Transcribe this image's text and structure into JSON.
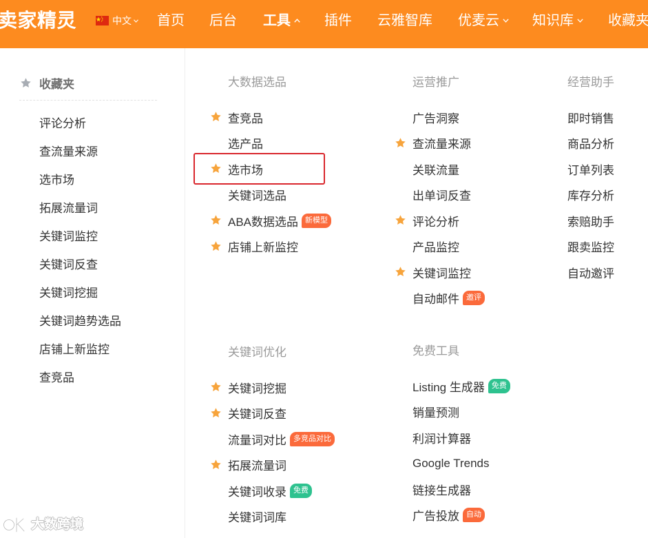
{
  "header": {
    "logo": "卖家精灵",
    "background": "#fd8b1f",
    "language": {
      "label": "中文",
      "flag_icon": "china-flag-icon",
      "chevron_icon": "chevron-down-icon"
    },
    "nav": [
      {
        "label": "首页"
      },
      {
        "label": "后台"
      },
      {
        "label": "工具",
        "active": true,
        "chevron_icon": "chevron-up-icon"
      },
      {
        "label": "插件"
      },
      {
        "label": "云雅智库"
      },
      {
        "label": "优麦云",
        "chevron_icon": "chevron-down-icon"
      },
      {
        "label": "知识库",
        "chevron_icon": "chevron-down-icon"
      },
      {
        "label": "收藏夹"
      }
    ]
  },
  "favorites": {
    "title": "收藏夹",
    "icon": "star-icon",
    "icon_color": "#a8adb4",
    "items": [
      "评论分析",
      "查流量来源",
      "选市场",
      "拓展流量词",
      "关键词监控",
      "关键词反查",
      "关键词挖掘",
      "关键词趋势选品",
      "店铺上新监控",
      "查竞品"
    ]
  },
  "menu": {
    "star_icon": "star-icon",
    "star_color": "#f7a43c",
    "highlight_color": "#d9262c",
    "groups": [
      {
        "title": "大数据选品",
        "items": [
          {
            "label": "查竞品",
            "starred": true
          },
          {
            "label": "选产品"
          },
          {
            "label": "选市场",
            "starred": true,
            "highlighted": true
          },
          {
            "label": "关键词选品"
          },
          {
            "label": "ABA数据选品",
            "starred": true,
            "badge": "新模型",
            "badge_color": "#fb6a3b"
          },
          {
            "label": "店铺上新监控",
            "starred": true
          }
        ]
      },
      {
        "title": "运营推广",
        "items": [
          {
            "label": "广告洞察"
          },
          {
            "label": "查流量来源",
            "starred": true
          },
          {
            "label": "关联流量"
          },
          {
            "label": "出单词反查"
          },
          {
            "label": "评论分析",
            "starred": true
          },
          {
            "label": "产品监控"
          },
          {
            "label": "关键词监控",
            "starred": true
          },
          {
            "label": "自动邮件",
            "badge": "邀评",
            "badge_color": "#fb6a3b"
          }
        ]
      },
      {
        "title": "经营助手",
        "items": [
          {
            "label": "即时销售"
          },
          {
            "label": "商品分析"
          },
          {
            "label": "订单列表"
          },
          {
            "label": "库存分析"
          },
          {
            "label": "索赔助手"
          },
          {
            "label": "跟卖监控"
          },
          {
            "label": "自动邀评"
          }
        ]
      },
      {
        "title": "关键词优化",
        "items": [
          {
            "label": "关键词挖掘",
            "starred": true
          },
          {
            "label": "关键词反查",
            "starred": true
          },
          {
            "label": "流量词对比",
            "badge": "多竞品对比",
            "badge_color": "#fb6a3b"
          },
          {
            "label": "拓展流量词",
            "starred": true
          },
          {
            "label": "关键词收录",
            "badge": "免费",
            "badge_color": "#2ec28f"
          },
          {
            "label": "关键词词库"
          }
        ]
      },
      {
        "title": "免费工具",
        "items": [
          {
            "label": "Listing 生成器",
            "badge": "免费",
            "badge_color": "#2ec28f"
          },
          {
            "label": "销量预测"
          },
          {
            "label": "利润计算器"
          },
          {
            "label": "Google Trends"
          },
          {
            "label": "链接生成器"
          },
          {
            "label": "广告投放",
            "badge": "自动",
            "badge_color": "#fb6a3b"
          }
        ]
      }
    ]
  },
  "watermark": {
    "text": "大数跨境",
    "icon": "watermark-logo-icon"
  }
}
